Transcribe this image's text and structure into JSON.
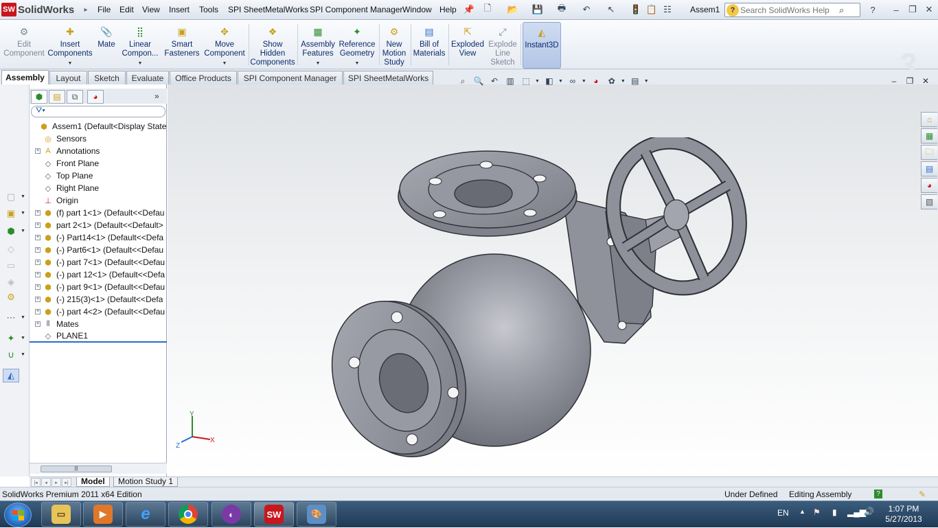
{
  "app": {
    "name": "SolidWorks",
    "doc_name": "Assem1",
    "edition": "SolidWorks Premium 2011 x64 Edition"
  },
  "menu": [
    "File",
    "Edit",
    "View",
    "Insert",
    "Tools",
    "SPI SheetMetalWorks",
    "SPI Component Manager",
    "Window",
    "Help"
  ],
  "search": {
    "placeholder": "Search SolidWorks Help"
  },
  "commands": {
    "edit_component": "Edit\nComponent",
    "insert_components": "Insert\nComponents",
    "mate": "Mate",
    "linear_component": "Linear\nCompon...",
    "smart_fasteners": "Smart\nFasteners",
    "move_component": "Move\nComponent",
    "show_hidden": "Show\nHidden\nComponents",
    "assembly_features": "Assembly\nFeatures",
    "reference_geometry": "Reference\nGeometry",
    "new_motion_study": "New\nMotion\nStudy",
    "bill_of_materials": "Bill of\nMaterials",
    "exploded_view": "Exploded\nView",
    "explode_line_sketch": "Explode\nLine\nSketch",
    "instant3d": "Instant3D"
  },
  "tabs": [
    "Assembly",
    "Layout",
    "Sketch",
    "Evaluate",
    "Office Products",
    "SPI Component Manager",
    "SPI SheetMetalWorks"
  ],
  "tree": [
    {
      "label": "Assem1  (Default<Display State-1",
      "icon": "assembly-icon",
      "expand": "",
      "indent": 0
    },
    {
      "label": "Sensors",
      "icon": "sensors-icon",
      "expand": "",
      "indent": 1
    },
    {
      "label": "Annotations",
      "icon": "annotations-icon",
      "expand": "+",
      "indent": 1
    },
    {
      "label": "Front Plane",
      "icon": "plane-icon",
      "expand": "",
      "indent": 1
    },
    {
      "label": "Top Plane",
      "icon": "plane-icon",
      "expand": "",
      "indent": 1
    },
    {
      "label": "Right Plane",
      "icon": "plane-icon",
      "expand": "",
      "indent": 1
    },
    {
      "label": "Origin",
      "icon": "origin-icon",
      "expand": "",
      "indent": 1
    },
    {
      "label": "(f) part 1<1> (Default<<Defau",
      "icon": "part-icon",
      "expand": "+",
      "indent": 1
    },
    {
      "label": "part 2<1> (Default<<Default>",
      "icon": "part-icon",
      "expand": "+",
      "indent": 1
    },
    {
      "label": "(-) Part14<1> (Default<<Defa",
      "icon": "part-icon",
      "expand": "+",
      "indent": 1
    },
    {
      "label": "(-) Part6<1> (Default<<Defau",
      "icon": "part-icon",
      "expand": "+",
      "indent": 1
    },
    {
      "label": "(-) part 7<1> (Default<<Defau",
      "icon": "part-icon",
      "expand": "+",
      "indent": 1
    },
    {
      "label": "(-) part 12<1> (Default<<Defa",
      "icon": "part-icon",
      "expand": "+",
      "indent": 1
    },
    {
      "label": "(-) part 9<1> (Default<<Defau",
      "icon": "part-icon",
      "expand": "+",
      "indent": 1
    },
    {
      "label": "(-) 215(3)<1> (Default<<Defa",
      "icon": "part-icon",
      "expand": "+",
      "indent": 1
    },
    {
      "label": "(-) part 4<2> (Default<<Defau",
      "icon": "part-icon",
      "expand": "+",
      "indent": 1
    },
    {
      "label": "Mates",
      "icon": "mates-icon",
      "expand": "+",
      "indent": 1
    },
    {
      "label": "PLANE1",
      "icon": "plane-icon",
      "expand": "",
      "indent": 1
    }
  ],
  "bottom_tabs": [
    "Model",
    "Motion Study 1"
  ],
  "status": {
    "left": "SolidWorks Premium 2011 x64 Edition",
    "state1": "Under Defined",
    "state2": "Editing Assembly"
  },
  "triad": {
    "x": "X",
    "y": "Y",
    "z": "Z"
  },
  "taskbar": {
    "lang": "EN",
    "time": "1:07 PM",
    "date": "5/27/2013",
    "sw_label": "SW"
  },
  "colors": {
    "accent": "#1f62b8",
    "model_gray": "#8d8f98",
    "sw_red": "#c8161d"
  }
}
